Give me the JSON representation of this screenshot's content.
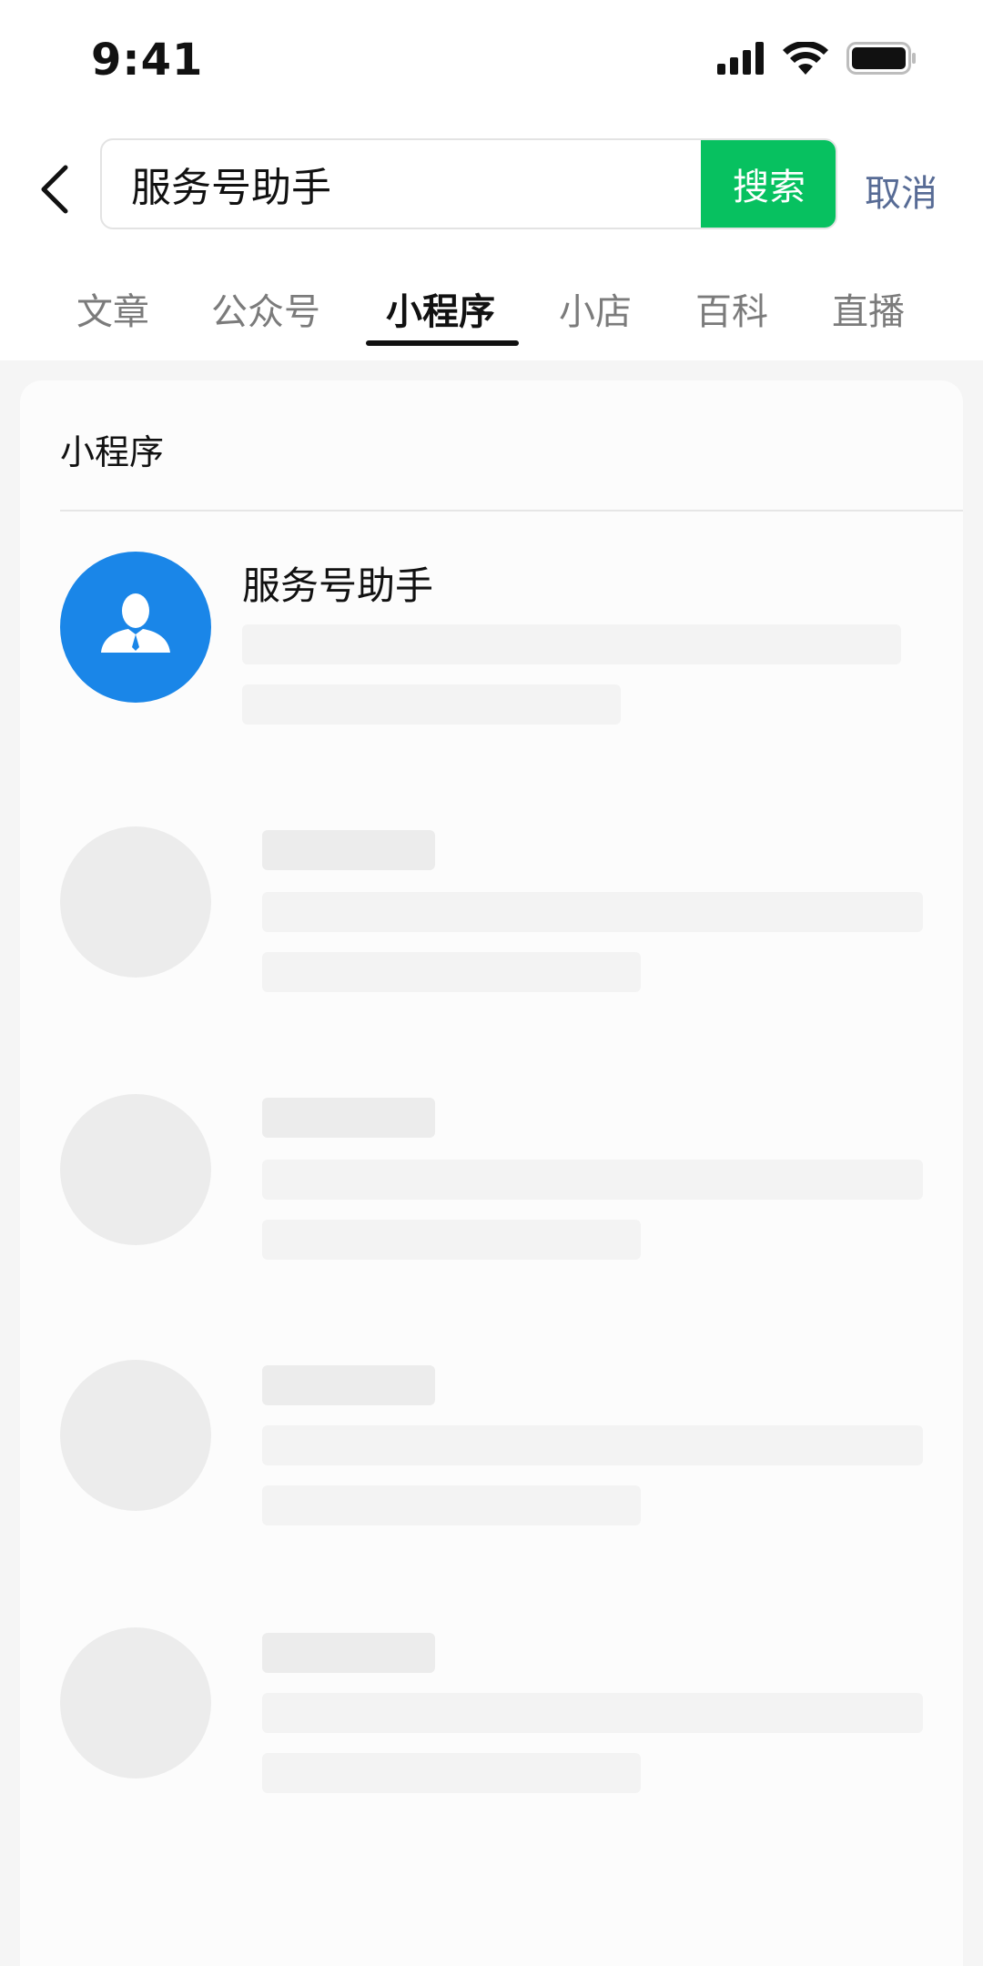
{
  "status_bar": {
    "time": "9:41",
    "icons": [
      "cellular-signal-icon",
      "wifi-icon",
      "battery-icon"
    ]
  },
  "header": {
    "back_icon": "chevron-left-icon",
    "search_value": "服务号助手",
    "search_button": "搜索",
    "cancel": "取消"
  },
  "tabs": [
    {
      "label": "文章",
      "active": false
    },
    {
      "label": "公众号",
      "active": false
    },
    {
      "label": "小程序",
      "active": true
    },
    {
      "label": "小店",
      "active": false
    },
    {
      "label": "百科",
      "active": false
    },
    {
      "label": "直播",
      "active": false
    }
  ],
  "section": {
    "title": "小程序"
  },
  "results": [
    {
      "name": "服务号助手",
      "avatar_icon": "person-icon",
      "avatar_color": "#1a86e8"
    }
  ],
  "colors": {
    "accent_green": "#07c160",
    "link_blue": "#576b95",
    "skeleton": "#ececec"
  }
}
